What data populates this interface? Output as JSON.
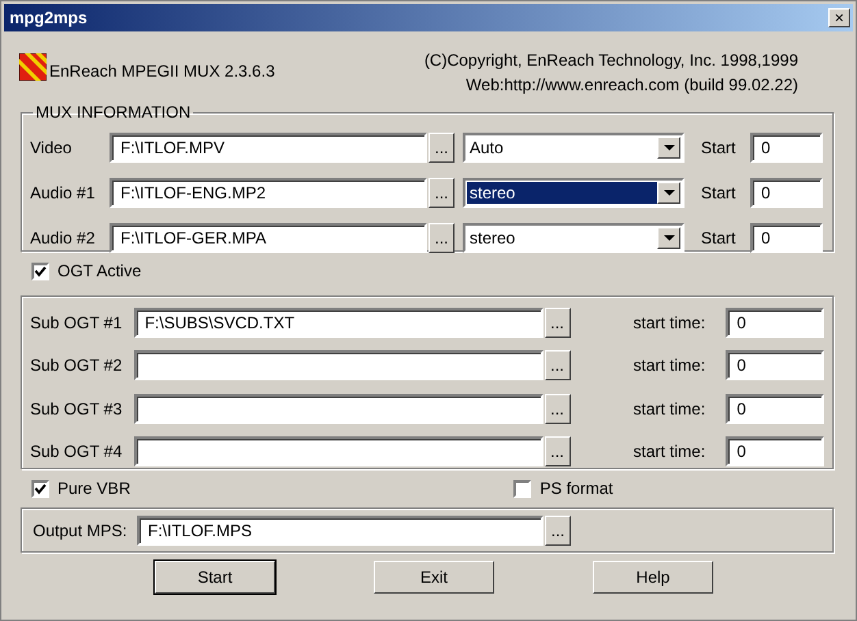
{
  "window": {
    "title": "mpg2mps",
    "close": "×"
  },
  "header": {
    "product": "EnReach MPEGII MUX 2.3.6.3",
    "copyright": "(C)Copyright, EnReach Technology, Inc. 1998,1999",
    "web": "Web:http://www.enreach.com  (build 99.02.22)"
  },
  "mux": {
    "title": "MUX INFORMATION",
    "rows": [
      {
        "label": "Video",
        "file": "F:\\ITLOF.MPV",
        "browse": "...",
        "mode": "Auto",
        "focused": false,
        "start_label": "Start",
        "start": "0"
      },
      {
        "label": "Audio #1",
        "file": "F:\\ITLOF-ENG.MP2",
        "browse": "...",
        "mode": "stereo",
        "focused": true,
        "start_label": "Start",
        "start": "0"
      },
      {
        "label": "Audio #2",
        "file": "F:\\ITLOF-GER.MPA",
        "browse": "...",
        "mode": "stereo",
        "focused": false,
        "start_label": "Start",
        "start": "0"
      }
    ]
  },
  "ogt_active": {
    "label": "OGT Active",
    "checked": true
  },
  "subs": [
    {
      "label": "Sub OGT #1",
      "file": "F:\\SUBS\\SVCD.TXT",
      "browse": "...",
      "time_label": "start time:",
      "time": "0"
    },
    {
      "label": "Sub OGT #2",
      "browse": "...",
      "time_label": "start time:",
      "time": "0"
    },
    {
      "label": "Sub OGT #3",
      "browse": "...",
      "time_label": "start time:",
      "time": "0"
    },
    {
      "label": "Sub OGT #4",
      "browse": "...",
      "time_label": "start time:",
      "time": "0"
    }
  ],
  "pure_vbr": {
    "label": "Pure VBR",
    "checked": true
  },
  "ps_format": {
    "label": "PS format",
    "checked": false
  },
  "output": {
    "label": "Output MPS:",
    "file": "F:\\ITLOF.MPS",
    "browse": "..."
  },
  "buttons": [
    {
      "label": "Start",
      "default": true
    },
    {
      "label": "Exit",
      "default": false
    },
    {
      "label": "Help",
      "default": false
    }
  ]
}
